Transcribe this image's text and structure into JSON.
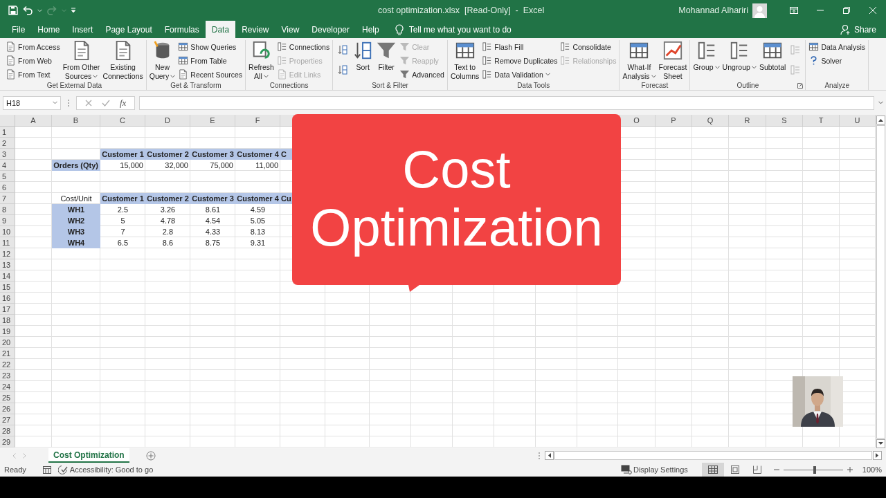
{
  "title_bar": {
    "title": "cost optimization.xlsx  [Read-Only]  -  Excel",
    "user": "Mohannad Alhariri",
    "redo_disabled": true
  },
  "tabs": [
    {
      "label": "File",
      "selected": false
    },
    {
      "label": "Home",
      "selected": false
    },
    {
      "label": "Insert",
      "selected": false
    },
    {
      "label": "Page Layout",
      "selected": false
    },
    {
      "label": "Formulas",
      "selected": false
    },
    {
      "label": "Data",
      "selected": true
    },
    {
      "label": "Review",
      "selected": false
    },
    {
      "label": "View",
      "selected": false
    },
    {
      "label": "Developer",
      "selected": false
    },
    {
      "label": "Help",
      "selected": false
    }
  ],
  "tell_me": "Tell me what you want to do",
  "share": "Share",
  "ribbon": {
    "groups": [
      {
        "label": "Get External Data",
        "launcher": false,
        "columns": [
          {
            "items": [
              {
                "kind": "small",
                "label": "From Access",
                "disabled": false,
                "dropdown": false
              },
              {
                "kind": "small",
                "label": "From Web",
                "disabled": false,
                "dropdown": false
              },
              {
                "kind": "small",
                "label": "From Text",
                "disabled": false,
                "dropdown": false
              }
            ]
          },
          {
            "items": [
              {
                "kind": "large",
                "lines": [
                  "From Other",
                  "Sources"
                ],
                "disabled": false,
                "dropdown": true
              }
            ]
          },
          {
            "items": [
              {
                "kind": "large",
                "lines": [
                  "Existing",
                  "Connections"
                ],
                "disabled": false,
                "dropdown": false
              }
            ]
          }
        ]
      },
      {
        "label": "Get & Transform",
        "launcher": false,
        "columns": [
          {
            "items": [
              {
                "kind": "large",
                "lines": [
                  "New",
                  "Query"
                ],
                "disabled": false,
                "dropdown": true
              }
            ]
          },
          {
            "items": [
              {
                "kind": "small",
                "label": "Show Queries",
                "disabled": false,
                "dropdown": false
              },
              {
                "kind": "small",
                "label": "From Table",
                "disabled": false,
                "dropdown": false
              },
              {
                "kind": "small",
                "label": "Recent Sources",
                "disabled": false,
                "dropdown": false
              }
            ]
          }
        ]
      },
      {
        "label": "Connections",
        "launcher": false,
        "columns": [
          {
            "items": [
              {
                "kind": "large",
                "lines": [
                  "Refresh",
                  "All"
                ],
                "disabled": false,
                "dropdown": true
              }
            ]
          },
          {
            "items": [
              {
                "kind": "small",
                "label": "Connections",
                "disabled": false,
                "dropdown": false
              },
              {
                "kind": "small",
                "label": "Properties",
                "disabled": true,
                "dropdown": false
              },
              {
                "kind": "small",
                "label": "Edit Links",
                "disabled": true,
                "dropdown": false
              }
            ]
          }
        ]
      },
      {
        "label": "Sort & Filter",
        "launcher": false,
        "columns": [
          {
            "items": [
              {
                "kind": "icon",
                "disabled": false,
                "dropdown": false
              },
              {
                "kind": "icon",
                "disabled": false,
                "dropdown": false
              }
            ]
          },
          {
            "items": [
              {
                "kind": "large",
                "lines": [
                  "Sort"
                ],
                "disabled": false,
                "dropdown": false
              }
            ]
          },
          {
            "items": [
              {
                "kind": "large",
                "lines": [
                  "Filter"
                ],
                "disabled": false,
                "dropdown": false
              }
            ]
          },
          {
            "items": [
              {
                "kind": "small",
                "label": "Clear",
                "disabled": true,
                "dropdown": false
              },
              {
                "kind": "small",
                "label": "Reapply",
                "disabled": true,
                "dropdown": false
              },
              {
                "kind": "small",
                "label": "Advanced",
                "disabled": false,
                "dropdown": false
              }
            ]
          }
        ]
      },
      {
        "label": "Data Tools",
        "launcher": false,
        "columns": [
          {
            "items": [
              {
                "kind": "large",
                "lines": [
                  "Text to",
                  "Columns"
                ],
                "disabled": false,
                "dropdown": false
              }
            ]
          },
          {
            "items": [
              {
                "kind": "small",
                "label": "Flash Fill",
                "disabled": false,
                "dropdown": false
              },
              {
                "kind": "small",
                "label": "Remove Duplicates",
                "disabled": false,
                "dropdown": false
              },
              {
                "kind": "small",
                "label": "Data Validation",
                "disabled": false,
                "dropdown": true
              }
            ]
          },
          {
            "items": [
              {
                "kind": "small",
                "label": "Consolidate",
                "disabled": false,
                "dropdown": false
              },
              {
                "kind": "small",
                "label": "Relationships",
                "disabled": true,
                "dropdown": false
              }
            ]
          }
        ]
      },
      {
        "label": "Forecast",
        "launcher": false,
        "columns": [
          {
            "items": [
              {
                "kind": "large",
                "lines": [
                  "What-If",
                  "Analysis"
                ],
                "disabled": false,
                "dropdown": true
              }
            ]
          },
          {
            "items": [
              {
                "kind": "large",
                "lines": [
                  "Forecast",
                  "Sheet"
                ],
                "disabled": false,
                "dropdown": false
              }
            ]
          }
        ]
      },
      {
        "label": "Outline",
        "launcher": true,
        "columns": [
          {
            "items": [
              {
                "kind": "large",
                "lines": [
                  "Group"
                ],
                "disabled": false,
                "dropdown": true
              }
            ]
          },
          {
            "items": [
              {
                "kind": "large",
                "lines": [
                  "Ungroup"
                ],
                "disabled": false,
                "dropdown": true
              }
            ]
          },
          {
            "items": [
              {
                "kind": "large",
                "lines": [
                  "Subtotal"
                ],
                "disabled": false,
                "dropdown": false
              }
            ]
          },
          {
            "items": [
              {
                "kind": "icon",
                "disabled": true,
                "dropdown": false
              },
              {
                "kind": "icon",
                "disabled": true,
                "dropdown": false
              }
            ]
          }
        ]
      },
      {
        "label": "Analyze",
        "launcher": false,
        "columns": [
          {
            "items": [
              {
                "kind": "small",
                "label": "Data Analysis",
                "disabled": false,
                "dropdown": false
              },
              {
                "kind": "small",
                "label": "Solver",
                "disabled": false,
                "dropdown": false
              }
            ]
          }
        ]
      }
    ]
  },
  "formula_bar": {
    "name_box": "H18",
    "fx": "fx"
  },
  "columns": [
    {
      "letter": "A"
    },
    {
      "letter": "B"
    },
    {
      "letter": "C"
    },
    {
      "letter": "D"
    },
    {
      "letter": "E"
    },
    {
      "letter": "F"
    },
    {},
    {},
    {},
    {},
    {},
    {},
    {},
    {},
    {
      "letter": "O"
    },
    {
      "letter": "P"
    },
    {
      "letter": "Q"
    },
    {
      "letter": "R"
    },
    {
      "letter": "S"
    },
    {
      "letter": "T"
    },
    {
      "letter": "U"
    }
  ],
  "rows": [
    {
      "number": "1"
    },
    {
      "number": "2"
    },
    {
      "number": "3",
      "cells": [
        {
          "kind": "blank"
        },
        {
          "kind": "blank"
        },
        {
          "kind": "header",
          "text": "Customer 1"
        },
        {
          "kind": "header",
          "text": "Customer 2"
        },
        {
          "kind": "header",
          "text": "Customer 3"
        },
        {
          "kind": "header",
          "text": "Customer 4"
        },
        {
          "kind": "header-cut",
          "text": "C"
        }
      ]
    },
    {
      "number": "4",
      "cells": [
        {
          "kind": "blank"
        },
        {
          "kind": "label",
          "text": "Orders (Qty)"
        },
        {
          "kind": "qty",
          "text": "15,000"
        },
        {
          "kind": "qty",
          "text": "32,000"
        },
        {
          "kind": "qty",
          "text": "75,000"
        },
        {
          "kind": "qty",
          "text": "11,000"
        }
      ]
    },
    {
      "number": "5"
    },
    {
      "number": "6"
    },
    {
      "number": "7",
      "cells": [
        {
          "kind": "blank"
        },
        {
          "kind": "caption",
          "text": "Cost/Unit"
        },
        {
          "kind": "header",
          "text": "Customer 1"
        },
        {
          "kind": "header",
          "text": "Customer 2"
        },
        {
          "kind": "header",
          "text": "Customer 3"
        },
        {
          "kind": "header",
          "text": "Customer 4"
        },
        {
          "kind": "header-cut",
          "text": "Cu"
        }
      ]
    },
    {
      "number": "8",
      "cells": [
        {
          "kind": "blank"
        },
        {
          "kind": "wh",
          "text": "WH1"
        },
        {
          "kind": "cost",
          "text": "2.5"
        },
        {
          "kind": "cost",
          "text": "3.26"
        },
        {
          "kind": "cost",
          "text": "8.61"
        },
        {
          "kind": "cost",
          "text": "4.59"
        }
      ]
    },
    {
      "number": "9",
      "cells": [
        {
          "kind": "blank"
        },
        {
          "kind": "wh",
          "text": "WH2"
        },
        {
          "kind": "cost",
          "text": "5"
        },
        {
          "kind": "cost",
          "text": "4.78"
        },
        {
          "kind": "cost",
          "text": "4.54"
        },
        {
          "kind": "cost",
          "text": "5.05"
        }
      ]
    },
    {
      "number": "10",
      "cells": [
        {
          "kind": "blank"
        },
        {
          "kind": "wh",
          "text": "WH3"
        },
        {
          "kind": "cost",
          "text": "7"
        },
        {
          "kind": "cost",
          "text": "2.8"
        },
        {
          "kind": "cost",
          "text": "4.33"
        },
        {
          "kind": "cost",
          "text": "8.13"
        }
      ]
    },
    {
      "number": "11",
      "cells": [
        {
          "kind": "blank"
        },
        {
          "kind": "wh",
          "text": "WH4"
        },
        {
          "kind": "cost",
          "text": "6.5"
        },
        {
          "kind": "cost",
          "text": "8.6"
        },
        {
          "kind": "cost",
          "text": "8.75"
        },
        {
          "kind": "cost",
          "text": "9.31"
        }
      ]
    },
    {
      "number": "12"
    },
    {
      "number": "13"
    },
    {
      "number": "14"
    },
    {
      "number": "15"
    },
    {
      "number": "16"
    },
    {
      "number": "17"
    },
    {
      "number": "18"
    },
    {
      "number": "19"
    },
    {
      "number": "20"
    },
    {
      "number": "21"
    },
    {
      "number": "22"
    },
    {
      "number": "23"
    },
    {
      "number": "24"
    },
    {
      "number": "25"
    },
    {
      "number": "26"
    },
    {
      "number": "27"
    },
    {
      "number": "28"
    },
    {
      "number": "29"
    }
  ],
  "sheet_tabs": [
    {
      "label": "Cost Optimization",
      "selected": true
    }
  ],
  "status_bar": {
    "mode": "Ready",
    "accessibility": "Accessibility: Good to go",
    "display_settings": "Display Settings",
    "views": [
      {
        "kind": "normal",
        "selected": true
      },
      {
        "kind": "page-layout",
        "selected": false
      },
      {
        "kind": "page-break",
        "selected": false
      }
    ],
    "zoom": {
      "level": 0.5,
      "reading": "100%"
    }
  },
  "callout": {
    "title": "Cost Optimization"
  }
}
